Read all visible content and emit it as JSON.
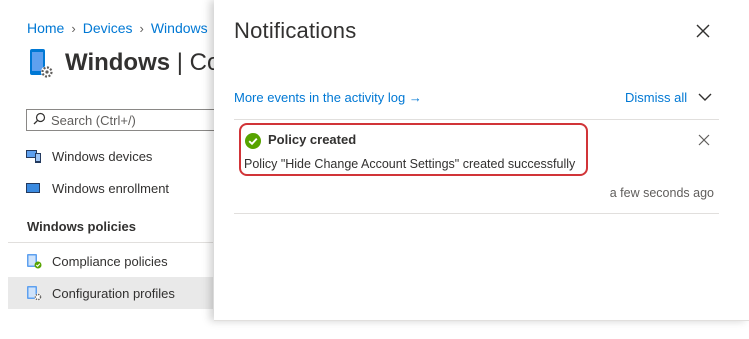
{
  "breadcrumb": {
    "items": [
      "Home",
      "Devices",
      "Windows"
    ]
  },
  "blade": {
    "title_bold": "Windows",
    "title_rest": " | Co",
    "icon": "device-settings-icon"
  },
  "search": {
    "placeholder": "Search (Ctrl+/)"
  },
  "nav": {
    "items": [
      {
        "label": "Windows devices",
        "icon": "windows-devices-icon"
      },
      {
        "label": "Windows enrollment",
        "icon": "windows-enrollment-icon"
      }
    ],
    "section_label": "Windows policies",
    "policy_items": [
      {
        "label": "Compliance policies",
        "icon": "compliance-policy-icon"
      },
      {
        "label": "Configuration profiles",
        "icon": "configuration-profile-icon",
        "active": true
      }
    ]
  },
  "notifications": {
    "title": "Notifications",
    "activity_link": "More events in the activity log →",
    "dismiss_all": "Dismiss all",
    "items": [
      {
        "title": "Policy created",
        "body": "Policy \"Hide Change Account Settings\" created successfully",
        "time": "a few seconds ago",
        "status": "success",
        "status_color": "#57a300",
        "highlight_color": "#d13438"
      }
    ]
  },
  "colors": {
    "link": "#0078d4",
    "text": "#323130",
    "active_nav_bg": "#e9e9e9"
  }
}
